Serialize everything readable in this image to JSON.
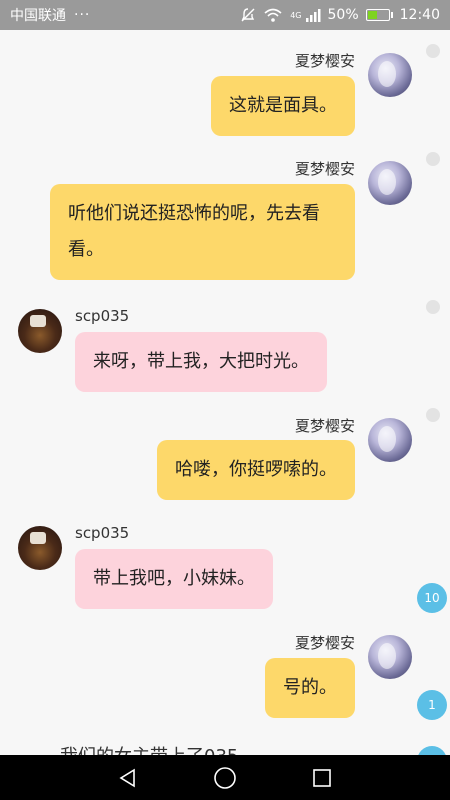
{
  "status_bar": {
    "carrier": "中国联通",
    "more": "···",
    "network": "4G",
    "battery_percent": "50%",
    "battery_level": 0.5,
    "time": "12:40"
  },
  "messages": [
    {
      "sender": "夏梦樱安",
      "text": "这就是面具。"
    },
    {
      "sender": "夏梦樱安",
      "text": "听他们说还挺恐怖的呢，先去看看。"
    },
    {
      "sender": "scp035",
      "text": "来呀，带上我，大把时光。"
    },
    {
      "sender": "夏梦樱安",
      "text": "哈喽，你挺啰嗦的。"
    },
    {
      "sender": "scp035",
      "text": "带上我吧，小妹妹。"
    },
    {
      "sender": "夏梦樱安",
      "text": "号的。"
    }
  ],
  "badges": [
    "10",
    "1"
  ],
  "partial_text": "我们的女主带上了035",
  "colors": {
    "self_bubble": "#fdd86a",
    "other_bubble": "#fdd3dc",
    "badge": "#5bbfe6"
  },
  "icons": {
    "nav_back": "triangle-back-icon",
    "nav_home": "circle-home-icon",
    "nav_recent": "square-recent-icon"
  }
}
